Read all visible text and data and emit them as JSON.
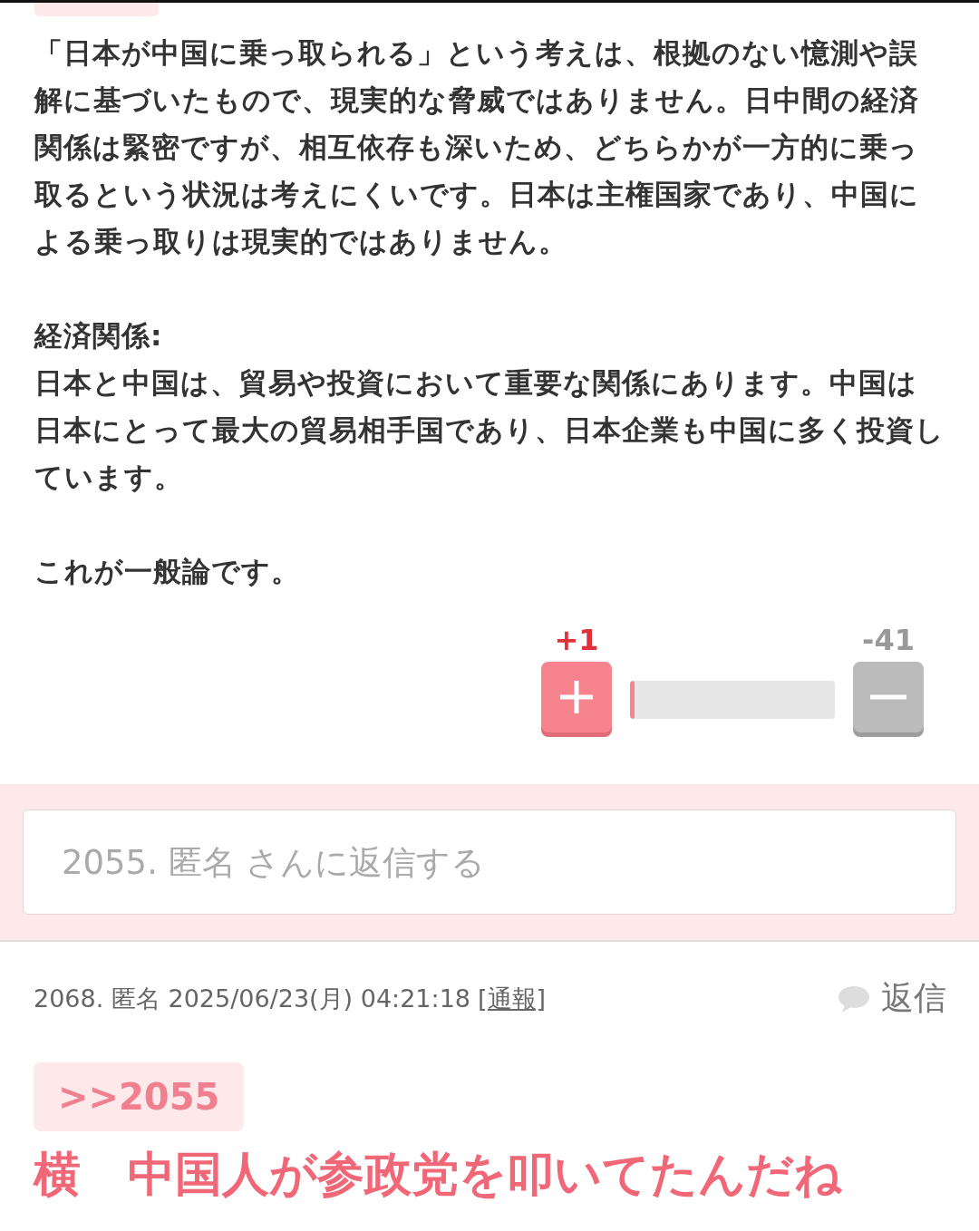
{
  "post": {
    "blocks": [
      [
        "「日本が中国に乗っ取られる」という考えは、根拠のない憶測や誤解に基づいたもので、現実的な脅威ではありません。日中間の経済関係は緊密ですが、相互依存も深いため、どちらかが一方的に乗っ取るという状況は考えにくいです。日本は主権国家であり、中国による乗っ取りは現実的ではありません。"
      ],
      [
        "経済関係:",
        "日本と中国は、貿易や投資において重要な関係にあります。中国は日本にとって最大の貿易相手国であり、日本企業も中国に多く投資しています。"
      ],
      [
        "これが一般論です。"
      ]
    ],
    "votes": {
      "plus": "+1",
      "minus": "-41",
      "level": 0.024
    }
  },
  "reply_box": {
    "placeholder": "2055. 匿名 さんに返信する"
  },
  "comments": [
    {
      "meta": "2068. 匿名 2025/06/23(月) 04:21:18",
      "report": "[通報]",
      "reply": "返信",
      "anchor": ">>2055",
      "body": "横　中国人が参政党を叩いてたんだね"
    }
  ]
}
